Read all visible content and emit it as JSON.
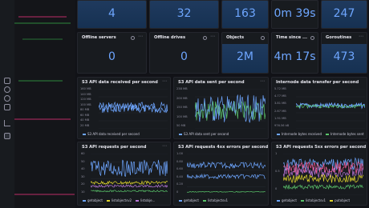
{
  "colors": {
    "accent": "#6ea6ff",
    "stat_bg": "#1f3a5e",
    "green": "#5ac46a",
    "yellow": "#e0d52d",
    "purple": "#b877d9",
    "pink": "#f25c95",
    "orange": "#ff9830"
  },
  "sidebar": {
    "icons": [
      "bell-icon",
      "search-icon",
      "gear-icon",
      "dashboard-icon",
      "chart-icon",
      "server-icon"
    ]
  },
  "stats_top": [
    {
      "value": "4"
    },
    {
      "value": "32"
    },
    {
      "value": "163"
    },
    {
      "value": "0m 39s"
    },
    {
      "value": "247"
    }
  ],
  "stats_mid": [
    {
      "title": "Offline servers",
      "value": "0"
    },
    {
      "title": "Offline drives",
      "value": "0"
    },
    {
      "title": "Objects",
      "value": "2M"
    },
    {
      "title": "Time since ...",
      "value": "4m 17s"
    },
    {
      "title": "Goroutines",
      "value": "473"
    }
  ],
  "charts": {
    "received": {
      "title": "S3 API data received per second",
      "yticks": [
        "160 MB",
        "140 MB",
        "120 MB",
        "100 MB",
        "80 MB",
        "60 MB",
        "40 MB",
        "20 MB"
      ],
      "legend": [
        "S3 API data received per second"
      ]
    },
    "sent": {
      "title": "S3 API data sent per second",
      "yticks": [
        "238 MB",
        "200 MB",
        "150 MB",
        "100 MB",
        "50 MB"
      ],
      "legend": [
        "S3 API data sent per second"
      ]
    },
    "internode": {
      "title": "Internode data transfer per second",
      "yticks": [
        "5.72 MB",
        "4.77 MB",
        "3.81 MB",
        "2.67 MB",
        "1.91 MB",
        "976.56 kB"
      ],
      "legend": [
        "Internode bytes received",
        "Internode bytes sent"
      ]
    },
    "requests": {
      "title": "S3 API requests per second",
      "yticks": [
        "60",
        "50",
        "40",
        "30",
        "20",
        "10"
      ],
      "legend": [
        "getobject",
        "listobjectsv2",
        "listobje..."
      ]
    },
    "errors4xx": {
      "title": "S3 API requests 4xx errors per second",
      "yticks": [
        "1.00",
        "0.80",
        "0.60",
        "0.40",
        "0.20",
        "0"
      ],
      "legend": [
        "getobject",
        "listobjectsv1"
      ]
    },
    "errors5xx": {
      "title": "S3 API requests 5xx errors per second",
      "yticks": [
        "1",
        "0.5",
        "0"
      ],
      "legend": [
        "getobject",
        "listobjectsv1",
        "putobject"
      ]
    }
  },
  "menu_label": "⋯"
}
